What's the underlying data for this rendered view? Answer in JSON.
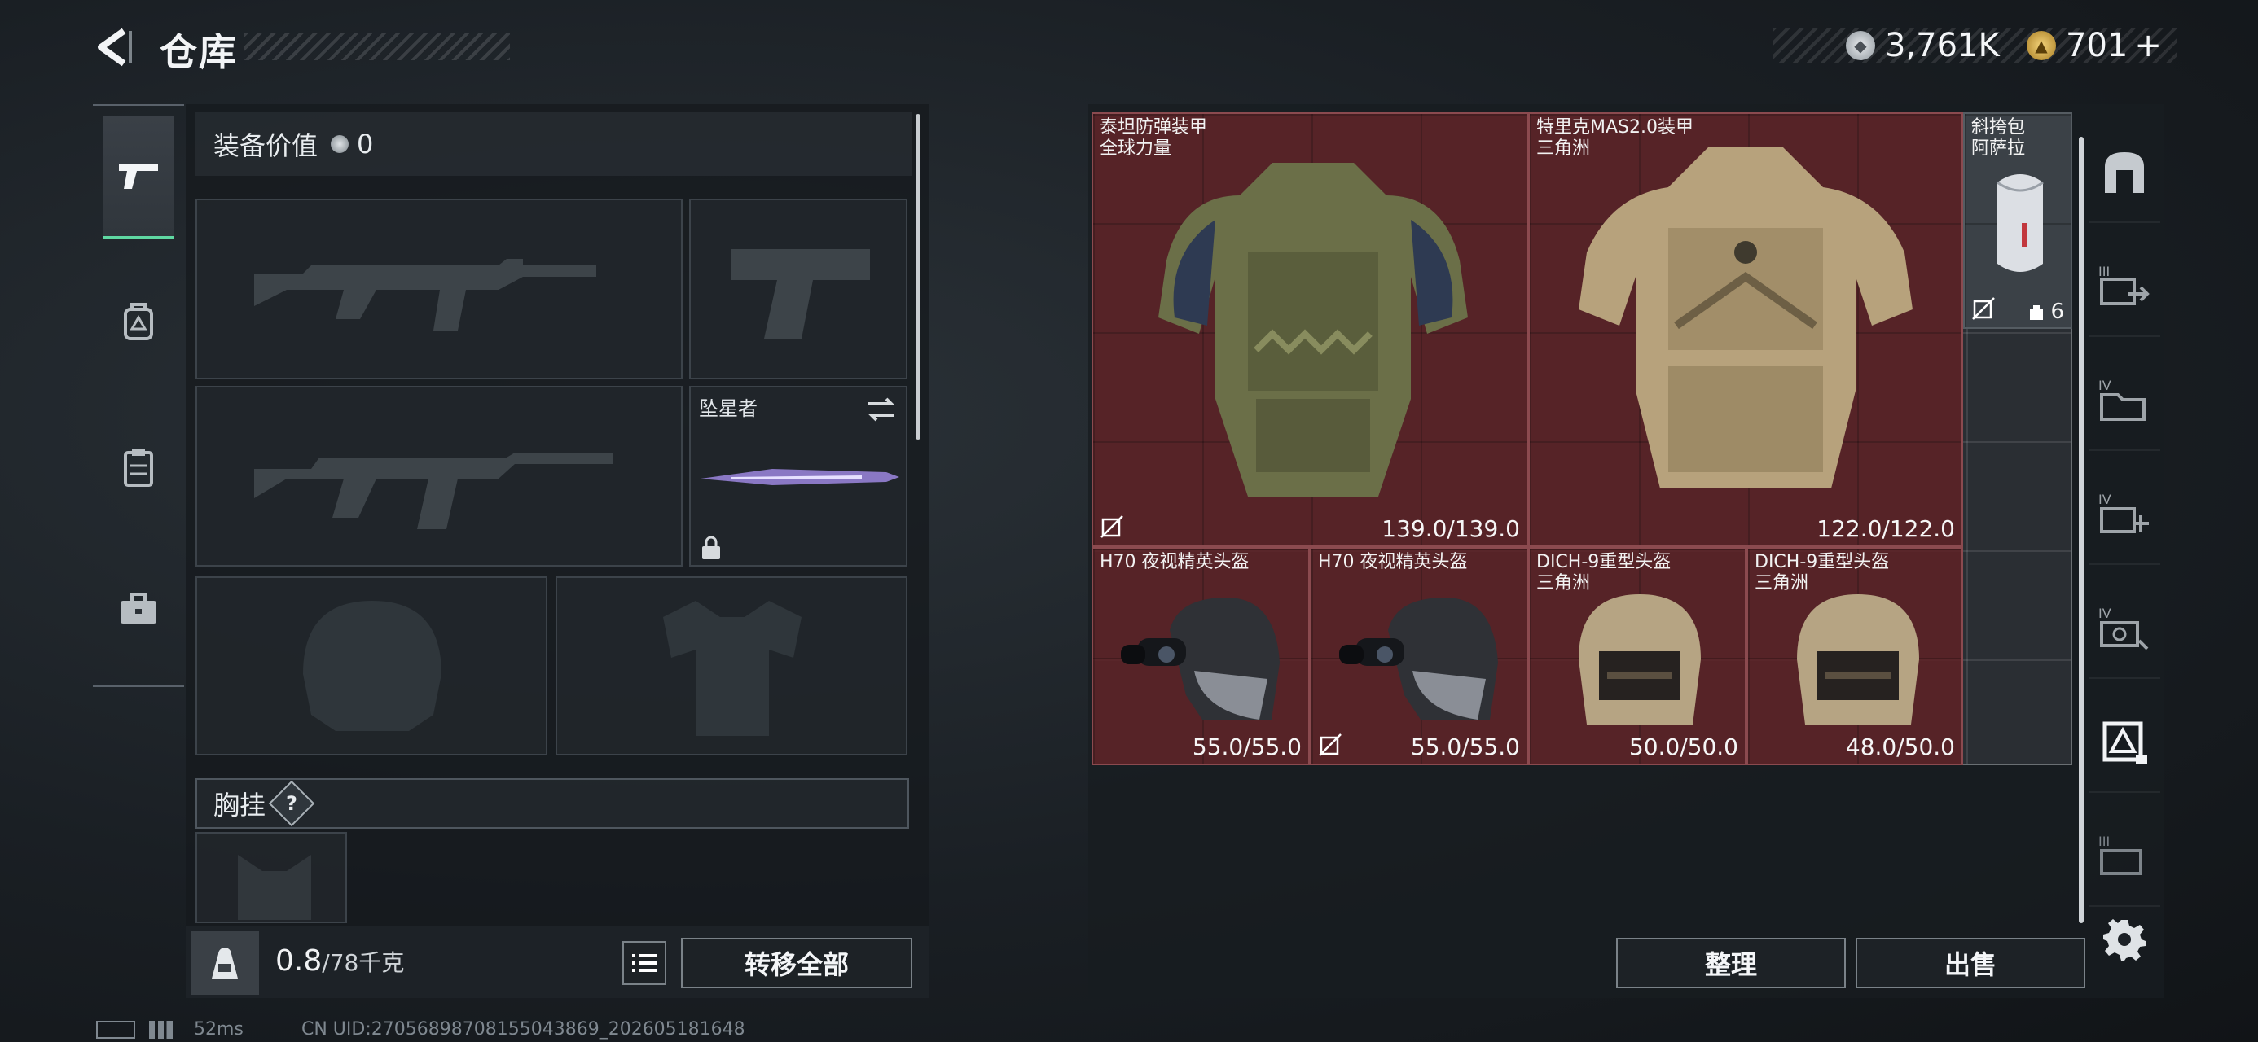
{
  "header": {
    "title": "仓库",
    "currency": [
      {
        "icon": "coin-icon",
        "value": "3,761K"
      },
      {
        "icon": "premium-coin-icon",
        "value": "701",
        "add": "+"
      }
    ]
  },
  "left_tabs": [
    {
      "name": "weapons",
      "icon": "pistol-icon",
      "active": true
    },
    {
      "name": "equipment",
      "icon": "backpack-icon",
      "active": false
    },
    {
      "name": "consumables",
      "icon": "clipboard-icon",
      "active": false
    },
    {
      "name": "tools",
      "icon": "toolbox-icon",
      "active": false
    }
  ],
  "loadout": {
    "equip_value_label": "装备价值",
    "equip_value": "0",
    "melee": {
      "name": "坠星者"
    },
    "chest_rig_label": "胸挂",
    "chest_help": "?"
  },
  "weight": {
    "current": "0.8",
    "max": "/78千克"
  },
  "buttons": {
    "list_icon": "list-icon",
    "transfer_all": "转移全部",
    "sort": "整理",
    "sell": "出售"
  },
  "storage_items": [
    {
      "name": "泰坦防弹装甲",
      "sub": "全球力量",
      "durability": "139.0/139.0",
      "not_insured": true
    },
    {
      "name": "特里克MAS2.0装甲",
      "sub": "三角洲",
      "durability": "122.0/122.0",
      "not_insured": false
    },
    {
      "name": "斜挎包",
      "sub": "阿萨拉",
      "capacity": "6",
      "not_insured": true
    },
    {
      "name": "H70 夜视精英头盔",
      "sub": "",
      "durability": "55.0/55.0",
      "not_insured": false
    },
    {
      "name": "H70 夜视精英头盔",
      "sub": "",
      "durability": "55.0/55.0",
      "not_insured": true
    },
    {
      "name": "DICH-9重型头盔",
      "sub": "三角洲",
      "durability": "50.0/50.0",
      "not_insured": false
    },
    {
      "name": "DICH-9重型头盔",
      "sub": "三角洲",
      "durability": "48.0/50.0",
      "not_insured": false
    }
  ],
  "right_nav": [
    "safe-box-icon",
    "storage-iii-transfer-icon",
    "storage-iv-folder-icon",
    "storage-iv-add-icon",
    "storage-iv-exchange-icon",
    "storage-delta-icon",
    "storage-iii-icon"
  ],
  "status": {
    "latency": "52ms",
    "uid": "CN UID:27056898708155043869_202605181648"
  },
  "colors": {
    "accent_green": "#5fd8a2",
    "item_red": "#5c2226"
  }
}
